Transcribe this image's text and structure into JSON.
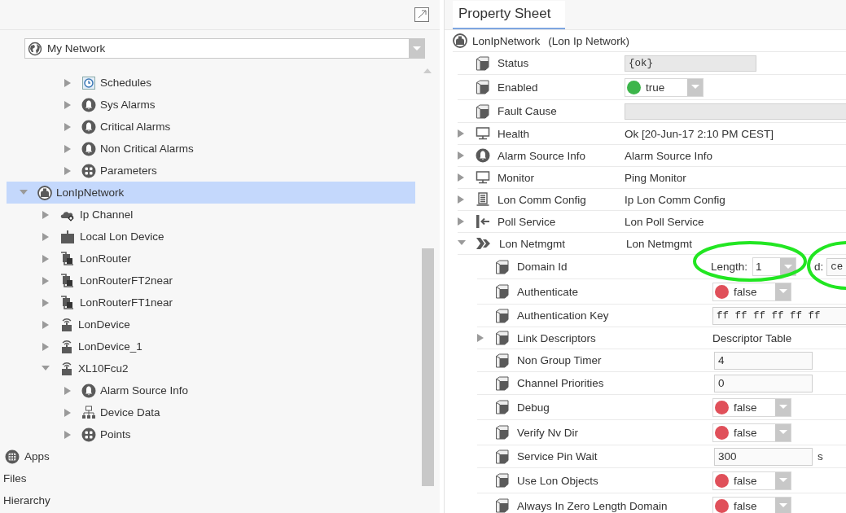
{
  "navigator": {
    "selector": {
      "kind": "globe",
      "value": "My Network"
    },
    "upper_items": [
      {
        "label": "Schedules",
        "kind": "schedule",
        "expanded": false
      },
      {
        "label": "Sys Alarms",
        "kind": "alarm",
        "expanded": false
      },
      {
        "label": "Critical Alarms",
        "kind": "alarm",
        "expanded": false
      },
      {
        "label": "Non Critical Alarms",
        "kind": "alarm",
        "expanded": false
      },
      {
        "label": "Parameters",
        "kind": "parameters",
        "expanded": false
      }
    ],
    "tree": [
      {
        "label": "LonIpNetwork",
        "kind": "network",
        "expanded": true,
        "selected": true,
        "children": [
          {
            "label": "Ip Channel",
            "kind": "cloud",
            "expanded": false,
            "selected": false
          },
          {
            "label": "Local Lon Device",
            "kind": "device",
            "expanded": false,
            "selected": false
          },
          {
            "label": "LonRouter",
            "kind": "router",
            "expanded": false,
            "selected": false
          },
          {
            "label": "LonRouterFT2near",
            "kind": "router",
            "expanded": false,
            "selected": false
          },
          {
            "label": "LonRouterFT1near",
            "kind": "router",
            "expanded": false,
            "selected": false
          },
          {
            "label": "LonDevice",
            "kind": "lon-device",
            "expanded": false,
            "selected": false
          },
          {
            "label": "LonDevice_1",
            "kind": "lon-device",
            "expanded": false,
            "selected": false
          },
          {
            "label": "XL10Fcu2",
            "kind": "lon-device",
            "expanded": true,
            "selected": false,
            "children": [
              {
                "label": "Alarm Source Info",
                "kind": "alarm",
                "expanded": false,
                "selected": false
              },
              {
                "label": "Device Data",
                "kind": "device-data",
                "expanded": false,
                "selected": false
              },
              {
                "label": "Points",
                "kind": "parameters",
                "expanded": false,
                "selected": false
              }
            ]
          }
        ]
      }
    ],
    "bottom_items": [
      {
        "label": "Apps",
        "kind": "apps"
      },
      {
        "label": "Files",
        "kind": "plain"
      },
      {
        "label": "Hierarchy",
        "kind": "plain"
      }
    ]
  },
  "property_sheet": {
    "tab": {
      "label": "Property Sheet",
      "selected": true
    },
    "header": {
      "name": "LonIpNetwork",
      "type": "(Lon Ip Network)",
      "kind": "network"
    },
    "rows": [
      {
        "name": "Status",
        "kind": "cube",
        "editor": {
          "kind": "readonly",
          "value": "{ok}"
        }
      },
      {
        "name": "Enabled",
        "kind": "cube",
        "editor": {
          "kind": "boolean",
          "on": true,
          "value": "true"
        }
      },
      {
        "name": "Fault Cause",
        "kind": "cube",
        "editor": {
          "kind": "readonly-wide"
        }
      },
      {
        "name": "Health",
        "kind": "monitor",
        "expanded": false,
        "editor": {
          "kind": "text",
          "value": "Ok [20-Jun-17 2:10 PM CEST]"
        }
      },
      {
        "name": "Alarm Source Info",
        "kind": "alarm",
        "expanded": false,
        "editor": {
          "kind": "text",
          "value": "Alarm Source Info"
        }
      },
      {
        "name": "Monitor",
        "kind": "monitor",
        "expanded": false,
        "editor": {
          "kind": "text",
          "value": "Ping Monitor"
        }
      },
      {
        "name": "Lon Comm Config",
        "kind": "server",
        "expanded": false,
        "editor": {
          "kind": "text",
          "value": "Ip Lon Comm Config"
        }
      },
      {
        "name": "Poll Service",
        "kind": "poll",
        "expanded": false,
        "editor": {
          "kind": "text",
          "value": "Lon Poll Service"
        }
      },
      {
        "name": "Lon Netmgmt",
        "kind": "netmgmt",
        "expanded": true,
        "editor": {
          "kind": "text",
          "value": "Lon Netmgmt"
        },
        "children": [
          {
            "name": "Domain Id",
            "kind": "cube",
            "editor": {
              "kind": "domain",
              "length_label": "Length:",
              "length": "1",
              "id_label": "d:",
              "id_value": "ce"
            }
          },
          {
            "name": "Authenticate",
            "kind": "cube",
            "editor": {
              "kind": "boolean",
              "on": false,
              "value": "false"
            }
          },
          {
            "name": "Authentication Key",
            "kind": "cube",
            "editor": {
              "kind": "mono-wide",
              "value": "ff ff ff ff ff ff"
            }
          },
          {
            "name": "Link Descriptors",
            "kind": "cube",
            "expanded": false,
            "editor": {
              "kind": "text",
              "value": "Descriptor Table"
            }
          },
          {
            "name": "Non Group Timer",
            "kind": "cube",
            "editor": {
              "kind": "field",
              "value": "4"
            }
          },
          {
            "name": "Channel Priorities",
            "kind": "cube",
            "editor": {
              "kind": "field",
              "value": "0"
            }
          },
          {
            "name": "Debug",
            "kind": "cube",
            "editor": {
              "kind": "boolean",
              "on": false,
              "value": "false"
            }
          },
          {
            "name": "Verify Nv Dir",
            "kind": "cube",
            "editor": {
              "kind": "boolean",
              "on": false,
              "value": "false"
            }
          },
          {
            "name": "Service Pin Wait",
            "kind": "cube",
            "editor": {
              "kind": "field",
              "value": "300",
              "unit": "s"
            }
          },
          {
            "name": "Use Lon Objects",
            "kind": "cube",
            "editor": {
              "kind": "boolean",
              "on": false,
              "value": "false"
            }
          },
          {
            "name": "Always In Zero Length Domain",
            "kind": "cube",
            "editor": {
              "kind": "boolean",
              "on": false,
              "value": "false"
            }
          }
        ]
      }
    ]
  }
}
